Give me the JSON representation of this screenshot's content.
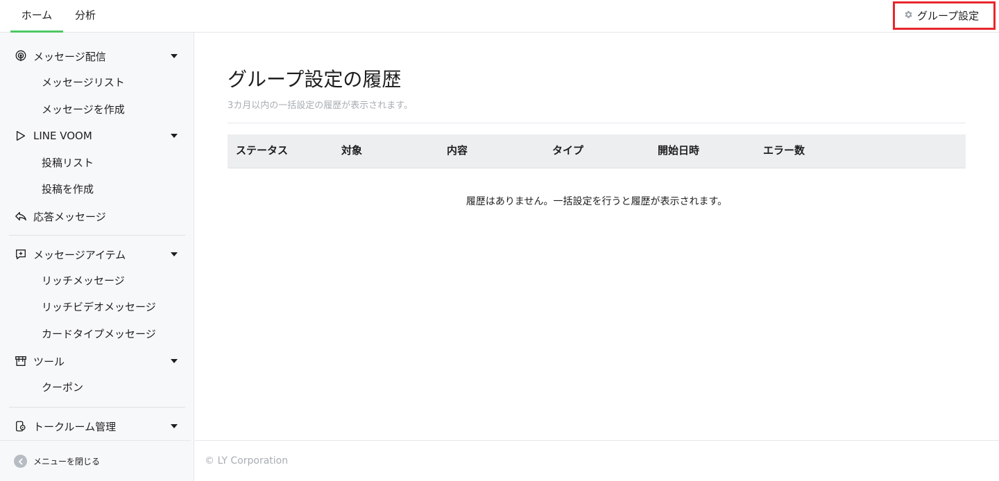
{
  "topbar": {
    "tabs": [
      {
        "label": "ホーム",
        "active": true
      },
      {
        "label": "分析",
        "active": false
      }
    ],
    "settings_button": {
      "icon": "gear-icon",
      "label": "グループ設定",
      "highlight_color": "#e8262b"
    }
  },
  "sidebar": {
    "sections": [
      {
        "icon": "broadcast-icon",
        "label": "メッセージ配信",
        "children": [
          "メッセージリスト",
          "メッセージを作成"
        ]
      },
      {
        "icon": "voom-play-icon",
        "label": "LINE VOOM",
        "children": [
          "投稿リスト",
          "投稿を作成"
        ]
      },
      {
        "icon": "reply-icon",
        "label": "応答メッセージ",
        "children": []
      },
      {
        "icon": "add-item-icon",
        "label": "メッセージアイテム",
        "children": [
          "リッチメッセージ",
          "リッチビデオメッセージ",
          "カードタイプメッセージ"
        ]
      },
      {
        "icon": "tool-store-icon",
        "label": "ツール",
        "children": [
          "クーポン"
        ]
      },
      {
        "icon": "chatroom-icon",
        "label": "トークルーム管理",
        "children": []
      }
    ],
    "collapse_label": "メニューを閉じる"
  },
  "main": {
    "title": "グループ設定の履歴",
    "description": "3カ月以内の一括設定の履歴が表示されます。",
    "table": {
      "columns": [
        "ステータス",
        "対象",
        "内容",
        "タイプ",
        "開始日時",
        "エラー数"
      ],
      "rows": [],
      "empty_message": "履歴はありません。一括設定を行うと履歴が表示されます。"
    },
    "footer": "© LY Corporation"
  },
  "colors": {
    "accent": "#4cc764",
    "highlight": "#e8262b"
  }
}
